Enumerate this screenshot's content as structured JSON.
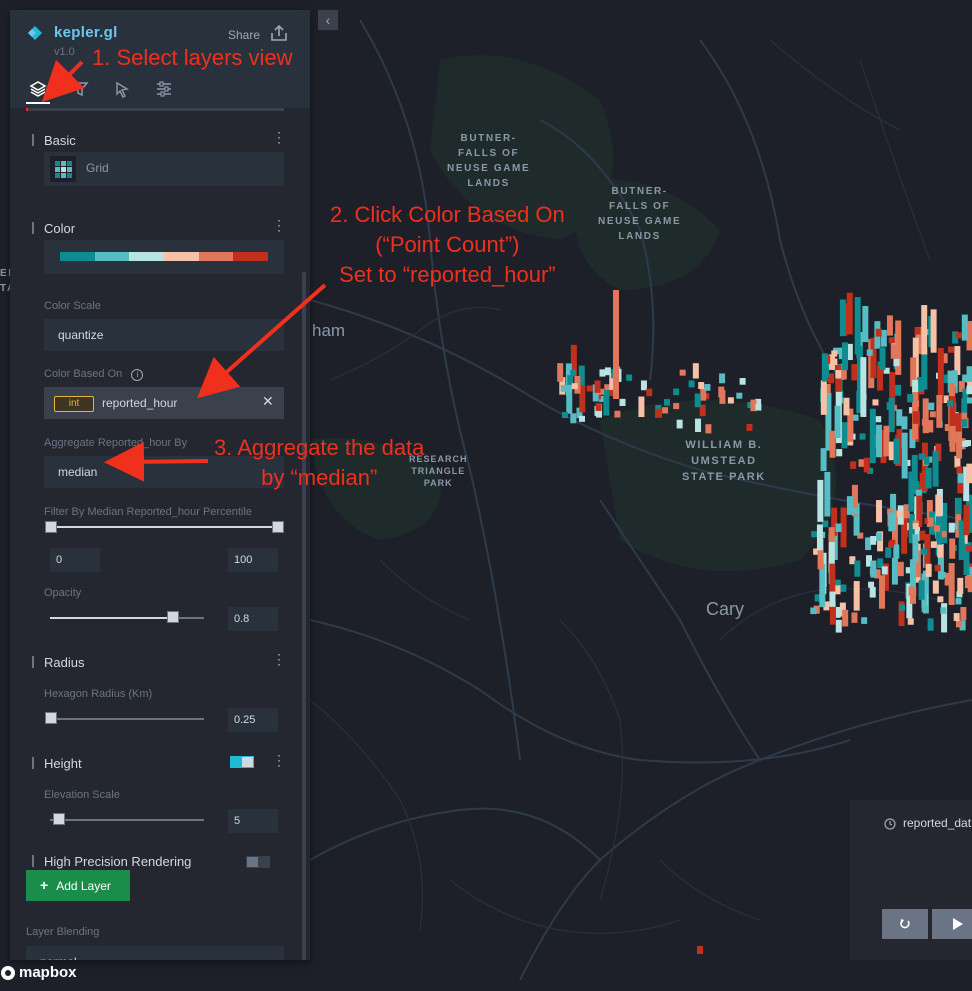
{
  "app": {
    "title": "kepler.gl",
    "version": "v1.0",
    "share_label": "Share"
  },
  "tabs": [
    {
      "icon": "layers-icon",
      "active": true
    },
    {
      "icon": "filter-icon",
      "active": false
    },
    {
      "icon": "interaction-icon",
      "active": false
    },
    {
      "icon": "map-style-icon",
      "active": false
    }
  ],
  "layer": {
    "basic": {
      "title": "Basic",
      "type_label": "Grid"
    },
    "color": {
      "title": "Color",
      "palette": [
        "#0e8c8f",
        "#56bdc4",
        "#b7e3e3",
        "#f6c1a6",
        "#e0775a",
        "#c0301c"
      ],
      "scale_label": "Color Scale",
      "scale_value": "quantize",
      "based_on_label": "Color Based On",
      "based_on_type": "int",
      "based_on_value": "reported_hour",
      "aggregate_label": "Aggregate Reported_hour By",
      "aggregate_value": "median",
      "filter_label": "Filter By Median Reported_hour Percentile",
      "filter_min": "0",
      "filter_max": "100",
      "opacity_label": "Opacity",
      "opacity_value": "0.8"
    },
    "radius": {
      "title": "Radius",
      "label": "Hexagon Radius (Km)",
      "value": "0.25"
    },
    "height": {
      "title": "Height",
      "label": "Elevation Scale",
      "value": "5"
    },
    "high_precision": {
      "title": "High Precision Rendering"
    },
    "add_layer": "Add Layer",
    "blending_label": "Layer Blending",
    "blending_value": "normal"
  },
  "map": {
    "labels": {
      "butner1": [
        "BUTNER-",
        "FALLS OF",
        "NEUSE GAME",
        "LANDS"
      ],
      "butner2": [
        "BUTNER-",
        "FALLS OF",
        "NEUSE GAME",
        "LANDS"
      ],
      "umstead": [
        "WILLIAM B.",
        "UMSTEAD",
        "STATE PARK"
      ],
      "research": [
        "RESEARCH",
        "TRIANGLE",
        "PARK"
      ],
      "cary": "Cary",
      "durham_partial": "ham",
      "left_edge_1": "EN",
      "left_edge_2": "TA"
    },
    "attribution": "mapbox"
  },
  "time_panel": {
    "label": "reported_dat"
  },
  "annotations": {
    "step1": "1. Select layers view",
    "step2": [
      "2. Click Color Based On",
      "(“Point Count”)",
      "Set to “reported_hour”"
    ],
    "step3": [
      "3. Aggregate the data",
      "by “median”"
    ]
  },
  "colors": {
    "annotation": "#f02f1d",
    "accent": "#6ec6e9",
    "add_layer": "#1a8d4a"
  }
}
